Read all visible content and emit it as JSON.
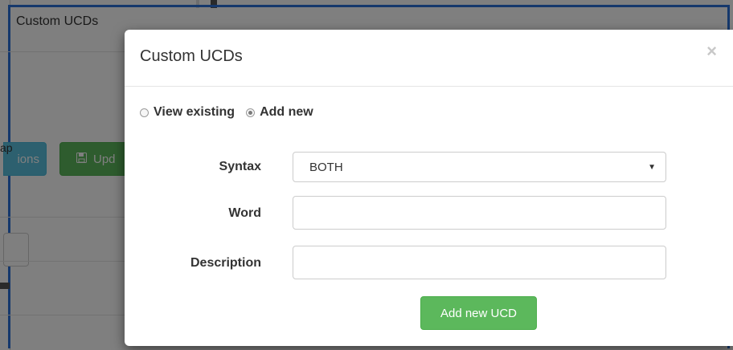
{
  "background": {
    "panel_title": "Custom UCDs",
    "text_fragment": "ap",
    "options_button_fragment": "ions",
    "update_button_fragment": "Upd",
    "update_icon": "floppy-disk-icon"
  },
  "modal": {
    "title": "Custom UCDs",
    "close_label": "×",
    "mode": {
      "view_existing_label": "View existing",
      "add_new_label": "Add new",
      "selected": "Add new"
    },
    "form": {
      "syntax_label": "Syntax",
      "syntax_value": "BOTH",
      "word_label": "Word",
      "word_value": "",
      "description_label": "Description",
      "description_value": ""
    },
    "submit_label": "Add new UCD"
  },
  "colors": {
    "primary_success": "#5cb85c",
    "info": "#5bc0de",
    "frame_blue": "#2a70d8"
  }
}
